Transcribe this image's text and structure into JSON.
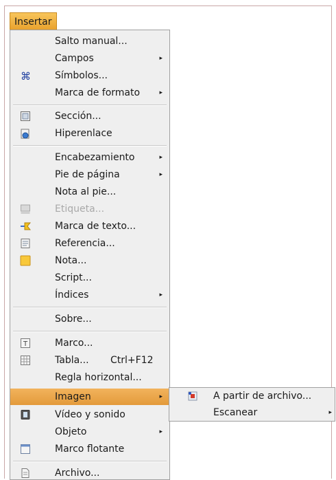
{
  "menubar": {
    "insert_label": "Insertar"
  },
  "menu": {
    "items": [
      {
        "label": "Salto manual...",
        "submenu": false
      },
      {
        "label": "Campos",
        "submenu": true
      },
      {
        "label": "Símbolos...",
        "submenu": false,
        "icon": "command-icon"
      },
      {
        "label": "Marca de formato",
        "submenu": true
      },
      {
        "label": "Sección...",
        "submenu": false,
        "icon": "section-icon"
      },
      {
        "label": "Hiperenlace",
        "submenu": false,
        "icon": "hyperlink-icon"
      },
      {
        "label": "Encabezamiento",
        "submenu": true
      },
      {
        "label": "Pie de página",
        "submenu": true
      },
      {
        "label": "Nota al pie...",
        "submenu": false
      },
      {
        "label": "Etiqueta...",
        "submenu": false,
        "disabled": true,
        "icon": "caption-icon"
      },
      {
        "label": "Marca de texto...",
        "submenu": false,
        "icon": "bookmark-icon"
      },
      {
        "label": "Referencia...",
        "submenu": false,
        "icon": "reference-icon"
      },
      {
        "label": "Nota...",
        "submenu": false,
        "icon": "note-icon"
      },
      {
        "label": "Script...",
        "submenu": false
      },
      {
        "label": "Índices",
        "submenu": true
      },
      {
        "label": "Sobre...",
        "submenu": false
      },
      {
        "label": "Marco...",
        "submenu": false,
        "icon": "frame-icon"
      },
      {
        "label": "Tabla...",
        "accel": "Ctrl+F12",
        "submenu": false,
        "icon": "table-icon"
      },
      {
        "label": "Regla horizontal...",
        "submenu": false
      },
      {
        "label": "Imagen",
        "submenu": true,
        "active": true
      },
      {
        "label": "Vídeo y sonido",
        "submenu": false,
        "icon": "film-icon"
      },
      {
        "label": "Objeto",
        "submenu": true
      },
      {
        "label": "Marco flotante",
        "submenu": false,
        "icon": "floating-frame-icon"
      },
      {
        "label": "Archivo...",
        "submenu": false,
        "icon": "file-icon"
      }
    ]
  },
  "submenu": {
    "items": [
      {
        "label": "A partir de archivo...",
        "submenu": false,
        "icon": "image-file-icon"
      },
      {
        "label": "Escanear",
        "submenu": true
      }
    ]
  },
  "colors": {
    "highlight": "#e9a22e",
    "menu_bg": "#efefef",
    "disabled_text": "#a9a9a9"
  }
}
